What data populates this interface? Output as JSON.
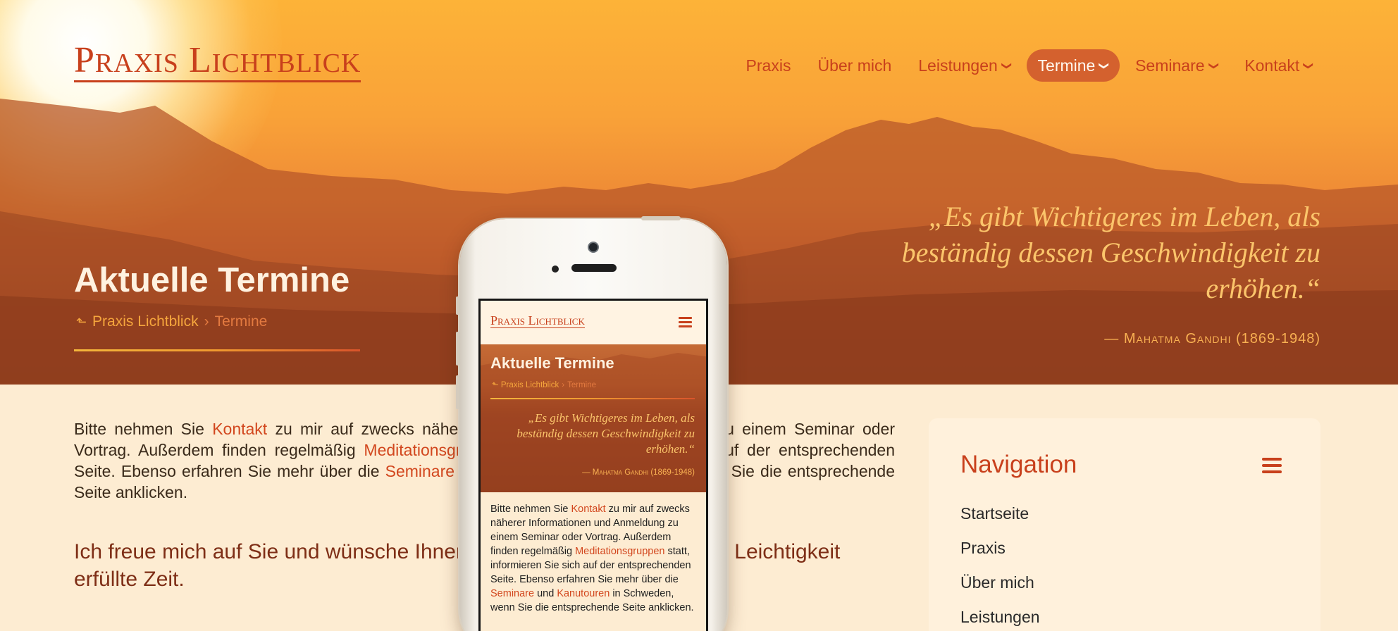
{
  "site": {
    "brand_first": "P",
    "brand_first_rest": "raxis",
    "brand_second": "L",
    "brand_second_rest": "ichtblick"
  },
  "nav": {
    "items": [
      {
        "label": "Praxis",
        "dropdown": false,
        "active": false
      },
      {
        "label": "Über mich",
        "dropdown": false,
        "active": false
      },
      {
        "label": "Leistungen",
        "dropdown": true,
        "active": false
      },
      {
        "label": "Termine",
        "dropdown": true,
        "active": true
      },
      {
        "label": "Seminare",
        "dropdown": true,
        "active": false
      },
      {
        "label": "Kontakt",
        "dropdown": true,
        "active": false
      }
    ]
  },
  "hero": {
    "title": "Aktuelle Termine",
    "breadcrumb_home": "Praxis Lichtblick",
    "breadcrumb_sep": "›",
    "breadcrumb_current": "Termine",
    "quote": "„Es gibt Wichtigeres im Leben, als beständig dessen Geschwindigkeit zu erhöhen.“",
    "cite": "— Mahatma Gandhi (1869-1948)"
  },
  "content": {
    "p1": "Bitte nehmen Sie ",
    "link_kontakt": "Kontakt",
    "p2": " zu mir auf zwecks näherer Informationen und Anmeldung zu einem Seminar oder Vortrag. Außerdem finden regelmäßig ",
    "link_meditation": "Meditationsgruppen",
    "p3": " statt, informieren Sie sich auf der entsprechenden Seite. Ebenso erfahren Sie mehr über die ",
    "link_seminare": "Seminare",
    "p4": " und ",
    "link_kanutouren": "Kanutouren",
    "p5": " in Schweden, wenn Sie die entsprechende Seite anklicken.",
    "lead": "Ich freue mich auf Sie und wünsche Ihnen eine mit Sonnenschein und Leichtigkeit erfüllte Zeit."
  },
  "sidebar": {
    "heading": "Navigation",
    "items": [
      "Startseite",
      "Praxis",
      "Über mich",
      "Leistungen"
    ]
  },
  "icons": {
    "dropdown": "chevron-down-icon",
    "breadcrumb_home": "arrow-up-icon",
    "menu": "hamburger-icon"
  },
  "colors": {
    "accent": "#c8401c",
    "active_nav_bg": "#d4612e",
    "page_bg": "#fdecd2",
    "quote_text": "#fbc56b"
  }
}
